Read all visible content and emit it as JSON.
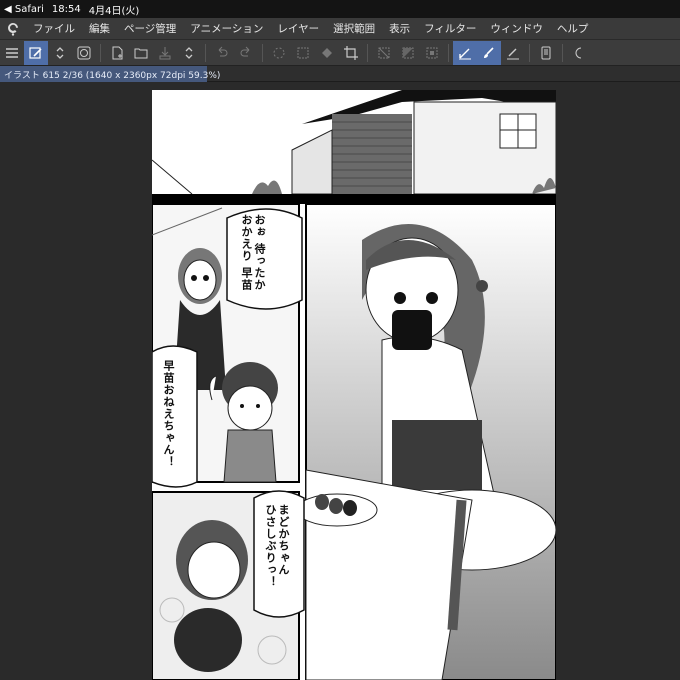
{
  "status": {
    "back_app": "Safari",
    "time": "18:54",
    "date": "4月4日(火)"
  },
  "menu": {
    "items": [
      "ファイル",
      "編集",
      "ページ管理",
      "アニメーション",
      "レイヤー",
      "選択範囲",
      "表示",
      "フィルター",
      "ウィンドウ",
      "ヘルプ"
    ]
  },
  "document": {
    "tab_label": "イラスト 615 2/36 (1640 x 2360px 72dpi 59.3%)"
  },
  "manga": {
    "bubble1": "おぉ 待ったか\nおかえり 早苗",
    "bubble2": "早苗おねえちゃん！",
    "bubble3": "まどかちゃん\nひさしぶりっ！"
  },
  "colors": {
    "statusbar": "#141414",
    "menubar": "#3a3a3a",
    "toolbar": "#3c3c3c",
    "selected_tool": "#4f6ea8",
    "doc_tab": "#45587c",
    "canvas_bg": "#2a2a2a"
  }
}
